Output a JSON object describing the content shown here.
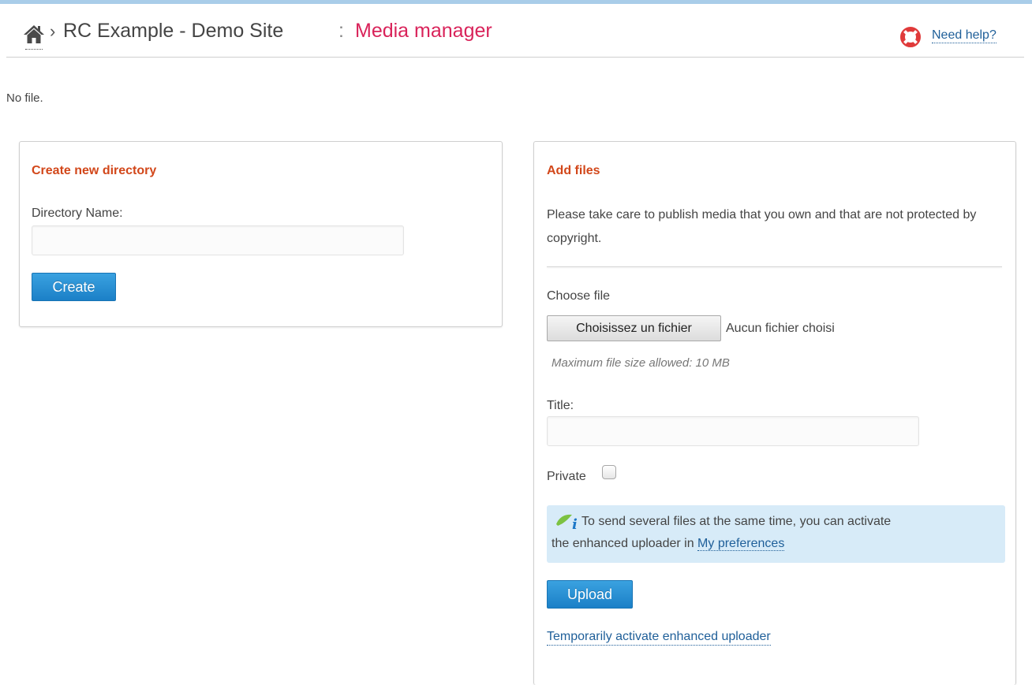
{
  "header": {
    "breadcrumb_separator": "›",
    "site_name": "RC Example - Demo Site",
    "colon": ":",
    "page_title": "Media manager",
    "help_link": "Need help?",
    "page_title_color": "#d9235a"
  },
  "status_text": "No file.",
  "create_directory": {
    "title": "Create new directory",
    "name_label": "Directory Name:",
    "name_value": "",
    "create_button": "Create"
  },
  "add_files": {
    "title": "Add files",
    "notice": "Please take care to publish media that you own and that are not protected by copyright.",
    "choose_file_label": "Choose file",
    "file_button": "Choisissez un fichier",
    "file_status": "Aucun fichier choisi",
    "max_size_hint": "Maximum file size allowed: 10 MB",
    "title_label": "Title:",
    "title_value": "",
    "private_label": "Private",
    "private_checked": false,
    "info_line1": "To send several files at the same time, you can activate",
    "info_line2": "the enhanced uploader in",
    "info_link": "My preferences",
    "upload_button": "Upload",
    "temp_link": "Temporarily activate enhanced uploader"
  },
  "icons": {
    "home": "home-icon",
    "help": "lifebuoy-icon",
    "info": "info-leaf-icon"
  },
  "colors": {
    "accent_blue": "#1b80c7",
    "section_title": "#d2471a",
    "link": "#1f5f99",
    "info_background": "#d7ebf8"
  }
}
